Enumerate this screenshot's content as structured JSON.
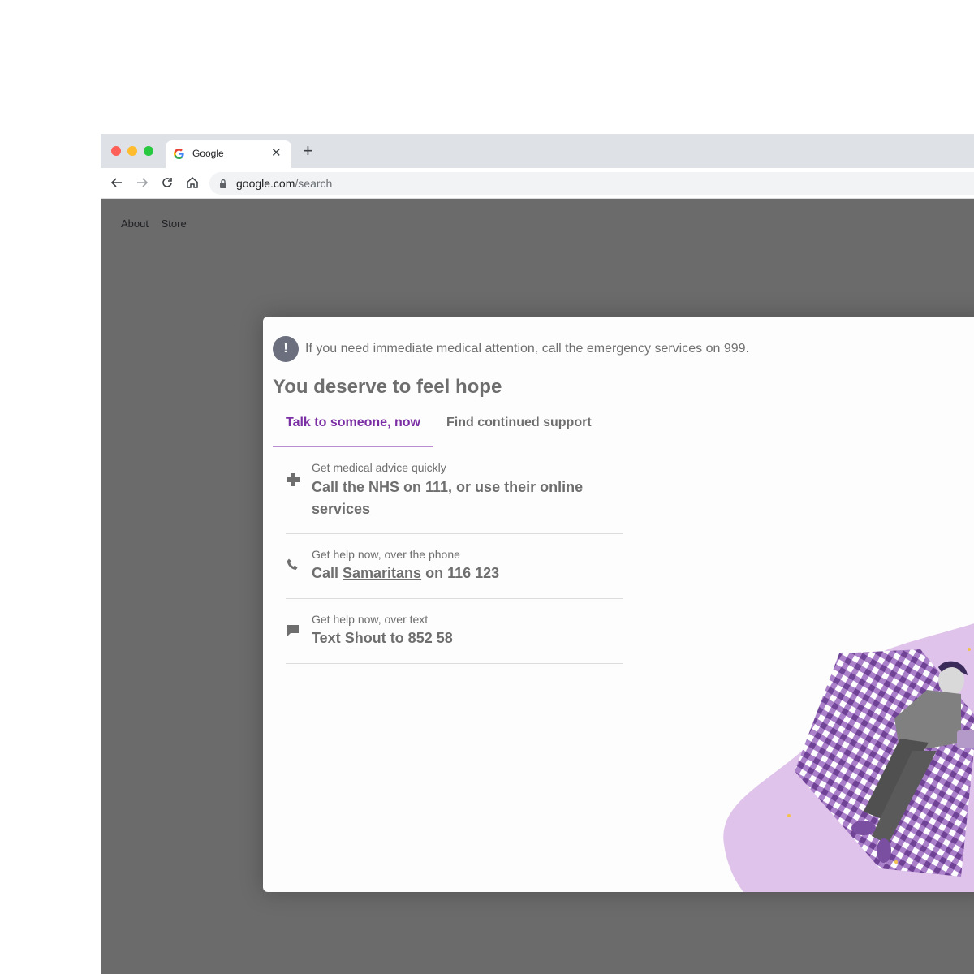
{
  "browser": {
    "tab_title": "Google",
    "url_host": "google.com",
    "url_path": "/search"
  },
  "page": {
    "links": [
      "About",
      "Store"
    ]
  },
  "panel": {
    "alert": "If you need immediate medical attention, call the emergency services on 999.",
    "headline": "You deserve to feel hope",
    "tabs": [
      "Talk to someone, now",
      "Find continued support"
    ],
    "items": [
      {
        "icon": "medical-cross-icon",
        "sub": "Get medical advice quickly",
        "main_prefix": "Call the NHS on 111, or use their ",
        "main_link": "online services",
        "main_suffix": ""
      },
      {
        "icon": "phone-icon",
        "sub": "Get help now, over the phone",
        "main_prefix": "Call ",
        "main_link": "Samaritans",
        "main_suffix": " on 116 123"
      },
      {
        "icon": "chat-bubble-icon",
        "sub": "Get help now, over text",
        "main_prefix": "Text ",
        "main_link": "Shout",
        "main_suffix": " to 852 58"
      }
    ]
  },
  "colors": {
    "accent_purple": "#7b2fa5",
    "illustration_bg": "#dfc3ea",
    "overlay": "#6b6b6b"
  }
}
